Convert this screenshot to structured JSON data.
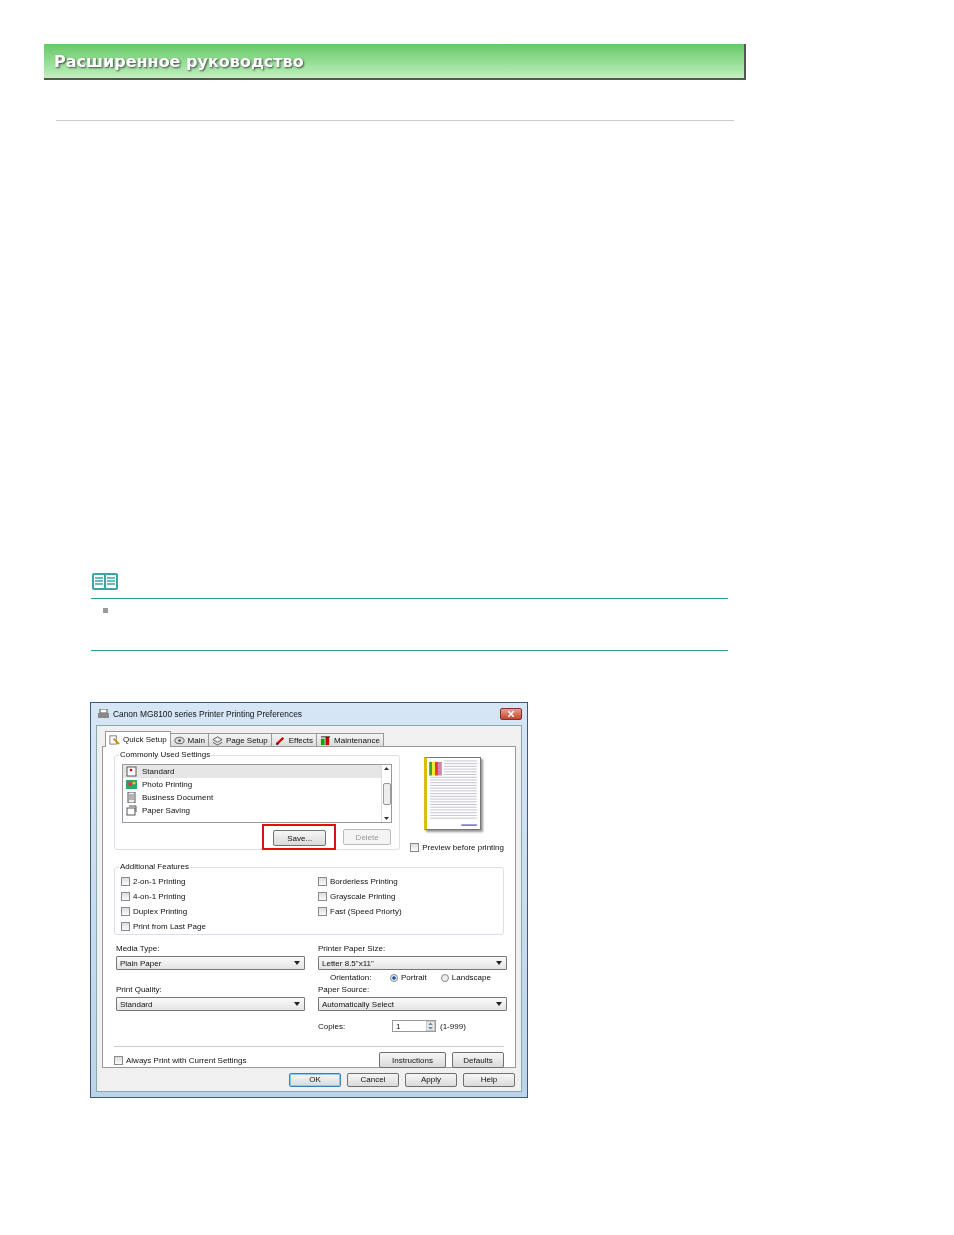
{
  "header": {
    "title": "Расширенное руководство"
  },
  "dialog": {
    "title": "Canon MG8100 series Printer Printing Preferences",
    "tabs": [
      {
        "label": "Quick Setup",
        "selected": true
      },
      {
        "label": "Main",
        "selected": false
      },
      {
        "label": "Page Setup",
        "selected": false
      },
      {
        "label": "Effects",
        "selected": false
      },
      {
        "label": "Maintenance",
        "selected": false
      }
    ],
    "commonly_used": {
      "label": "Commonly Used Settings",
      "items": [
        {
          "label": "Standard",
          "selected": true
        },
        {
          "label": "Photo Printing",
          "selected": false
        },
        {
          "label": "Business Document",
          "selected": false
        },
        {
          "label": "Paper Saving",
          "selected": false
        }
      ],
      "buttons": [
        {
          "label": "Save...",
          "disabled": false,
          "highlighted": true
        },
        {
          "label": "Delete",
          "disabled": true,
          "highlighted": false
        }
      ]
    },
    "preview_checkbox": {
      "label": "Preview before printing",
      "checked": false
    },
    "additional_features": {
      "label": "Additional Features",
      "items": [
        {
          "label": "2-on-1 Printing",
          "checked": false
        },
        {
          "label": "Borderless Printing",
          "checked": false
        },
        {
          "label": "4-on-1 Printing",
          "checked": false
        },
        {
          "label": "Grayscale Printing",
          "checked": false
        },
        {
          "label": "Duplex Printing",
          "checked": false
        },
        {
          "label": "Fast (Speed Priorty)",
          "checked": false
        },
        {
          "label": "Print from Last Page",
          "checked": false
        }
      ]
    },
    "media_type": {
      "label": "Media Type:",
      "value": "Plain Paper"
    },
    "paper_size": {
      "label": "Printer Paper Size:",
      "value": "Letter 8.5\"x11\""
    },
    "orientation": {
      "label": "Orientation:",
      "options": [
        {
          "label": "Portrait",
          "selected": true
        },
        {
          "label": "Landscape",
          "selected": false
        }
      ]
    },
    "print_quality": {
      "label": "Print Quality:",
      "value": "Standard"
    },
    "paper_source": {
      "label": "Paper Source:",
      "value": "Automatically Select"
    },
    "copies": {
      "label": "Copies:",
      "value": "1",
      "range": "(1-999)"
    },
    "always_print": {
      "label": "Always Print with Current Settings",
      "checked": false
    },
    "panel_buttons": [
      "Instructions",
      "Defaults"
    ],
    "footer_buttons": [
      {
        "label": "OK",
        "default": true
      },
      {
        "label": "Cancel",
        "default": false
      },
      {
        "label": "Apply",
        "default": false
      },
      {
        "label": "Help",
        "default": false
      }
    ]
  }
}
